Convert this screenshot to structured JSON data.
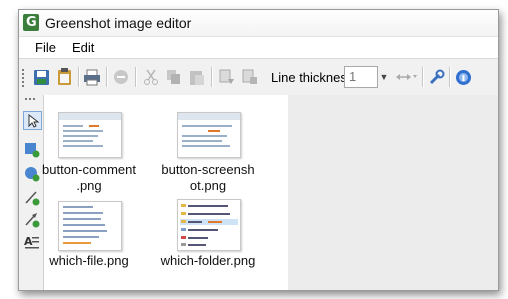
{
  "window": {
    "title": "Greenshot image editor",
    "logo_letter": "G"
  },
  "menu": {
    "items": [
      "File",
      "Edit"
    ]
  },
  "toolbar": {
    "line_thickness_label": "Line thickness",
    "line_thickness_value": "1",
    "icons": [
      "save-icon",
      "clipboard-icon",
      "print-icon",
      "delete-icon",
      "cut-icon",
      "copy-icon",
      "paste-icon",
      "bring-forward-icon",
      "send-backward-icon",
      "arrow-heads-icon",
      "settings-icon",
      "help-icon"
    ]
  },
  "tools": [
    "cursor-icon",
    "rectangle-icon",
    "ellipse-icon",
    "line-icon",
    "arrow-icon",
    "text-icon"
  ],
  "files": [
    {
      "name": "button-comment\n.png"
    },
    {
      "name": "button-screensh\not.png"
    },
    {
      "name": "which-file.png"
    },
    {
      "name": "which-folder.png"
    }
  ],
  "colors": {
    "accent": "#3b7d3a",
    "toolbar_bg": "#f1f1f1",
    "canvas_bg": "#ececec"
  }
}
